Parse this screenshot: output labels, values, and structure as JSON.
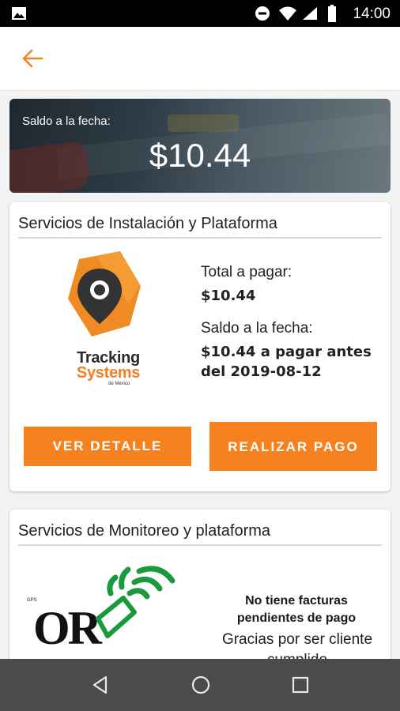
{
  "status_bar": {
    "time": "14:00",
    "icons": [
      "image-icon",
      "do-not-disturb-icon",
      "wifi-icon",
      "signal-icon",
      "battery-icon"
    ]
  },
  "app_bar": {
    "back_icon": "arrow-left-icon"
  },
  "balance": {
    "label": "Saldo a la fecha:",
    "amount": "$10.44"
  },
  "installation": {
    "title": "Servicios de Instalación y Plataforma",
    "logo": {
      "line1": "Tracking",
      "line2": "Systems",
      "line3": "de México"
    },
    "total_label": "Total a pagar:",
    "total_value": "$10.44",
    "balance_label": "Saldo a la fecha:",
    "balance_value": "$10.44 a pagar antes del 2019-08-12",
    "detail_button": "VER DETALLE",
    "pay_button": "REALIZAR PAGO"
  },
  "monitoring": {
    "title": "Servicios de Monitoreo y plataforma",
    "logo": {
      "text": "OR",
      "small": "GPS"
    },
    "no_pending": "No tiene facturas pendientes de pago",
    "thanks": "Gracias por ser cliente cumplido"
  },
  "colors": {
    "accent": "#f5821f",
    "status_bar": "#000000",
    "nav_bar": "#4b4b4b",
    "logo_green": "#1a9a3a"
  },
  "nav_bar": {
    "icons": [
      "back-triangle-icon",
      "home-circle-icon",
      "recents-square-icon"
    ]
  }
}
